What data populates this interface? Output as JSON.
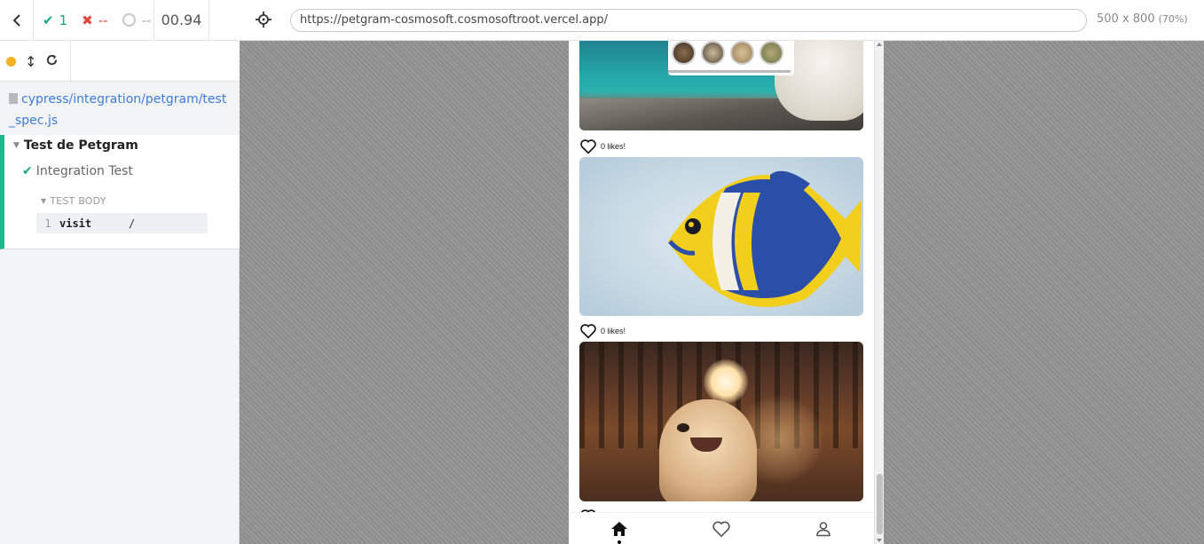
{
  "stats": {
    "passed": "1",
    "failed": "--",
    "pending": "--",
    "duration": "00.94"
  },
  "spec": {
    "path": "cypress/integration/petgram/test_spec.js"
  },
  "suite": {
    "title": "Test de Petgram",
    "test_title": "Integration Test",
    "body_label": "TEST BODY",
    "command": {
      "number": "1",
      "name": "visit",
      "arg": "/"
    }
  },
  "urlbar": {
    "url": "https://petgram-cosmosoft.cosmosoftroot.vercel.app/",
    "viewport_size": "500 x 800",
    "zoom": "(70%)"
  },
  "app": {
    "posts": [
      {
        "likes_label": "0 likes!"
      },
      {
        "likes_label": "0 likes!"
      }
    ],
    "nav": [
      "home-icon",
      "heart-icon",
      "user-icon"
    ]
  },
  "colors": {
    "pass": "#1fa87d",
    "fail": "#e0463b",
    "link": "#3d7de0",
    "suite_border": "#1fb88b",
    "running_dot": "#f4b21f"
  }
}
